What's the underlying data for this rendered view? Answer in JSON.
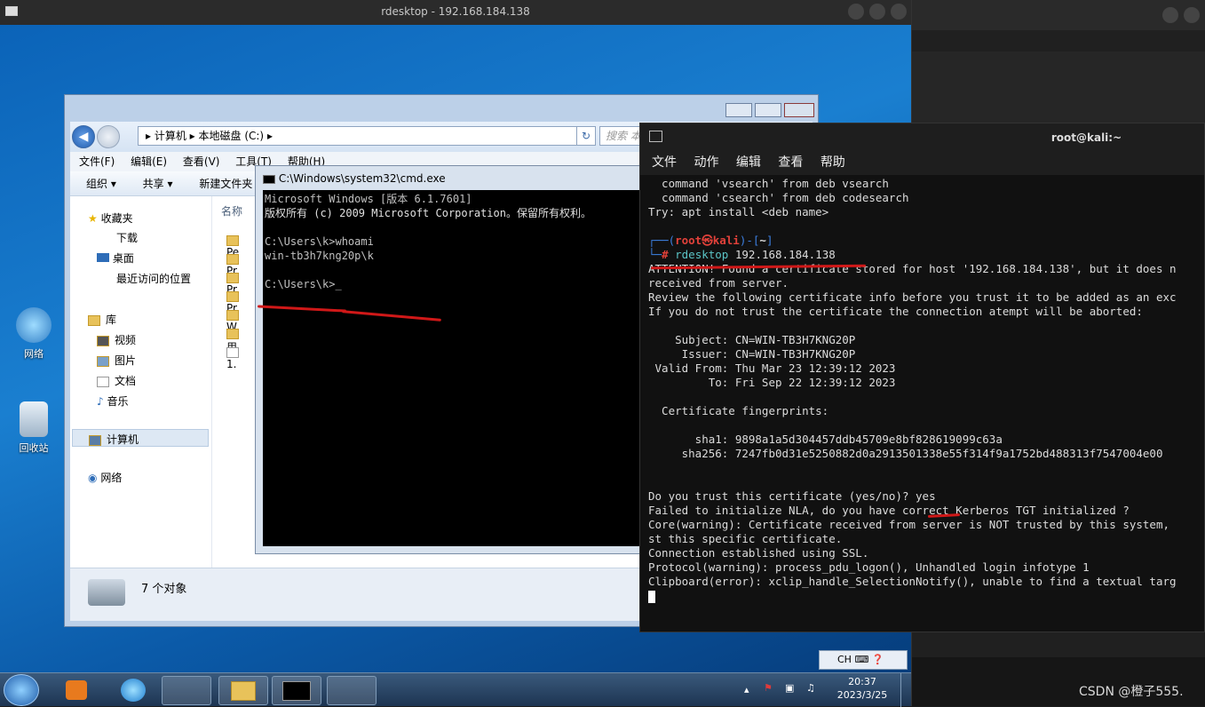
{
  "host": {
    "title": "rdesktop - 192.168.184.138"
  },
  "desktop": {
    "icons": [
      {
        "label": "网络",
        "icon": "network-icon"
      },
      {
        "label": "回收站",
        "icon": "recycle-bin-icon"
      }
    ]
  },
  "explorer": {
    "breadcrumb": [
      "计算机",
      "本地磁盘 (C:)"
    ],
    "search_placeholder": "搜索 本...",
    "menu": [
      "文件(F)",
      "编辑(E)",
      "查看(V)",
      "工具(T)",
      "帮助(H)"
    ],
    "toolbar": [
      "组织 ▾",
      "共享 ▾",
      "新建文件夹"
    ],
    "sidebar": [
      "收藏夹",
      "下载",
      "桌面",
      "最近访问的位置",
      "库",
      "视频",
      "图片",
      "文档",
      "音乐",
      "计算机",
      "网络"
    ],
    "column": "名称",
    "files": [
      "Pe",
      "Pr",
      "Pr",
      "Pr",
      "W",
      "用",
      "1."
    ],
    "status": "7 个对象"
  },
  "cmd": {
    "title": "C:\\Windows\\system32\\cmd.exe",
    "lines": [
      "Microsoft Windows [版本 6.1.7601]",
      "版权所有 (c) 2009 Microsoft Corporation。保留所有权利。",
      "",
      "C:\\Users\\k>whoami",
      "win-tb3h7kng20p\\k",
      "",
      "C:\\Users\\k>_"
    ]
  },
  "kali": {
    "title": "root@kali:~",
    "menu": [
      "文件",
      "动作",
      "编辑",
      "查看",
      "帮助"
    ],
    "pre_lines": [
      "  command 'vsearch' from deb vsearch",
      "  command 'csearch' from deb codesearch",
      "Try: apt install <deb name>"
    ],
    "prompt_user": "root㉿kali",
    "prompt_dir": "~",
    "command": "rdesktop",
    "command_arg": "192.168.184.138",
    "lines": [
      "ATTENTION! Found a certificate stored for host '192.168.184.138', but it does n",
      "received from server.",
      "Review the following certificate info before you trust it to be added as an exc",
      "If you do not trust the certificate the connection atempt will be aborted:",
      "",
      "    Subject: CN=WIN-TB3H7KNG20P",
      "     Issuer: CN=WIN-TB3H7KNG20P",
      " Valid From: Thu Mar 23 12:39:12 2023",
      "         To: Fri Sep 22 12:39:12 2023",
      "",
      "  Certificate fingerprints:",
      "",
      "       sha1: 9898a1a5d304457ddb45709e8bf828619099c63a",
      "     sha256: 7247fb0d31e5250882d0a2913501338e55f314f9a1752bd488313f7547004e00",
      "",
      ""
    ],
    "question": "Do you trust this certificate (yes/no)? ",
    "answer": "yes",
    "post_lines": [
      "Failed to initialize NLA, do you have correct Kerberos TGT initialized ?",
      "Core(warning): Certificate received from server is NOT trusted by this system,",
      "st this specific certificate.",
      "Connection established using SSL.",
      "Protocol(warning): process_pdu_logon(), Unhandled login infotype 1",
      "Clipboard(error): xclip_handle_SelectionNotify(), unable to find a textual targ"
    ]
  },
  "taskbar": {
    "lang": "CH",
    "time": "20:37",
    "date": "2023/3/25"
  },
  "watermark": "CSDN @橙子555."
}
